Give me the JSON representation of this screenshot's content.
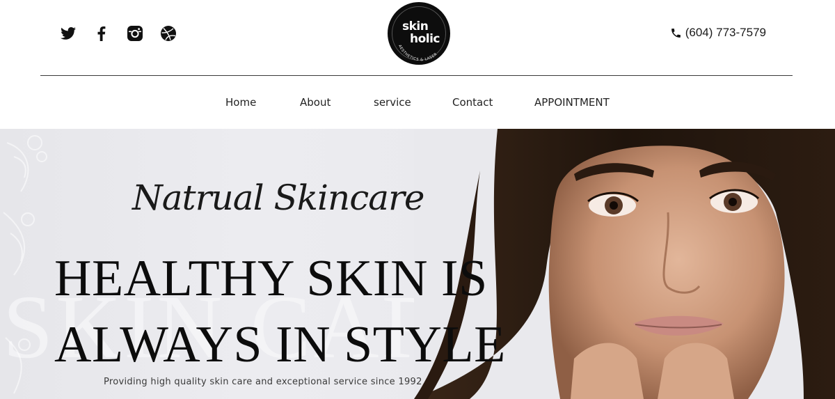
{
  "header": {
    "social": [
      {
        "icon": "twitter-icon"
      },
      {
        "icon": "facebook-icon"
      },
      {
        "icon": "instagram-icon"
      },
      {
        "icon": "dribbble-icon"
      }
    ],
    "logo": {
      "line1": "skin",
      "line2": "holic",
      "arc_text": "AESTHETICS & LASER"
    },
    "phone": {
      "icon": "phone-icon",
      "number": "(604) 773-7579"
    }
  },
  "nav": {
    "items": [
      {
        "label": "Home"
      },
      {
        "label": "About"
      },
      {
        "label": "service"
      },
      {
        "label": "Contact"
      },
      {
        "label": "APPOINTMENT"
      }
    ]
  },
  "hero": {
    "script_title": "Natrual Skincare",
    "headline_line1": "HEALTHY SKIN IS",
    "headline_line2": "ALWAYS IN STYLE",
    "tagline": "Providing high quality skin care and exceptional service since 1992",
    "watermark": "SKIN CARE"
  },
  "colors": {
    "text": "#111111",
    "hero_bg": "#e9e9ed",
    "logo_bg": "#0d0d0d"
  }
}
